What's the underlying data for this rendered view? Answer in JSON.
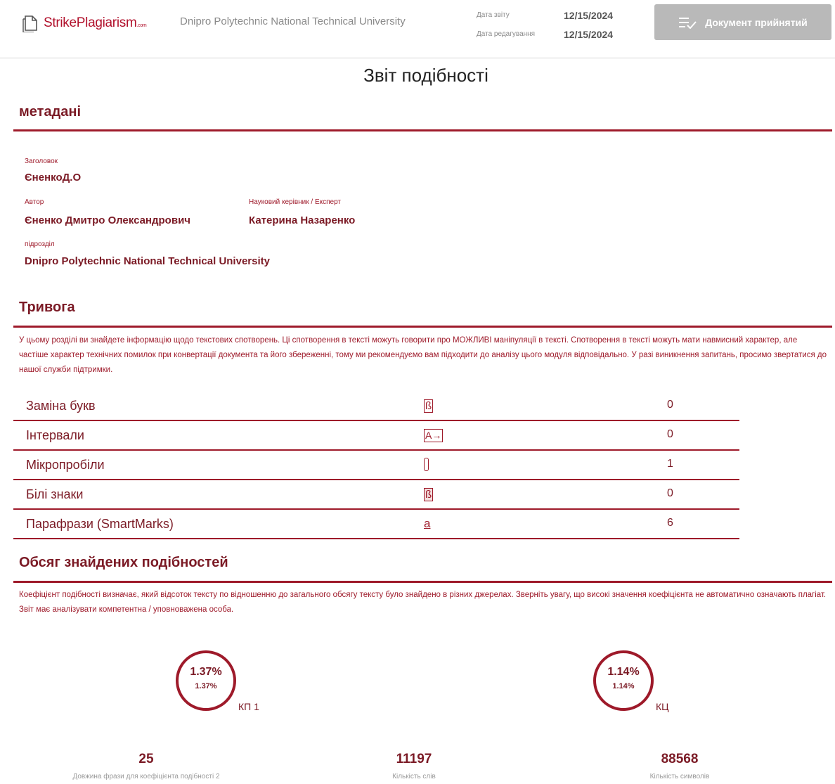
{
  "header": {
    "logo": {
      "strike": "Strike",
      "plagiarism": "Plagiarism",
      "com": ".com"
    },
    "university": "Dnipro Polytechnic National Technical University",
    "report_date_label": "Дата звіту",
    "report_date": "12/15/2024",
    "edit_date_label": "Дата редагування",
    "edit_date": "12/15/2024",
    "accept_button": "Документ прийнятий"
  },
  "title": "Звіт подібності",
  "metadata": {
    "heading": "метадані",
    "title_label": "Заголовок",
    "title_value": "ЄненкоД.О",
    "author_label": "Автор",
    "author_value": "Єненко Дмитро Олександрович",
    "supervisor_label": "Науковий керівник / Експерт",
    "supervisor_value": "Катерина Назаренко",
    "unit_label": "підрозділ",
    "unit_value": "Dnipro Polytechnic National Technical University"
  },
  "alert": {
    "heading": "Тривога",
    "description": "У цьому розділі ви знайдете інформацію щодо текстових спотворень. Ці спотворення в тексті можуть говорити про МОЖЛИВІ маніпуляції в тексті. Спотворення в тексті можуть мати навмисний характер, але частіше характер технічних помилок при конвертації документа та його збереженні, тому ми рекомендуємо вам підходити до аналізу цього модуля відповідально. У разі виникнення запитань, просимо звертатися до нашої служби підтримки.",
    "rows": [
      {
        "name": "Заміна букв",
        "icon": "letter-replace-icon",
        "glyph": "ß",
        "count": "0"
      },
      {
        "name": "Інтервали",
        "icon": "interval-arrow-icon",
        "glyph": "A→",
        "count": "0"
      },
      {
        "name": "Мікропробіли",
        "icon": "micro-space-icon",
        "glyph": "",
        "count": "1"
      },
      {
        "name": "Білі знаки",
        "icon": "white-chars-icon",
        "glyph": "ß",
        "count": "0"
      },
      {
        "name": "Парафрази (SmartMarks)",
        "icon": "paraphrase-icon",
        "glyph": "a",
        "count": "6"
      }
    ]
  },
  "similarity": {
    "heading": "Обсяг знайдених подібностей",
    "description": "Коефіцієнт подібності визначає, який відсоток тексту по відношенню до загального обсягу тексту було знайдено в різних джерелах. Зверніть увагу, що високі значення коефіцієнта не автоматично означають плагіат. Звіт має аналізувати компетентна / уповноважена особа.",
    "coef1": {
      "big": "1.37%",
      "small": "1.37%",
      "label": "КП 1"
    },
    "coef2": {
      "big": "1.14%",
      "small": "1.14%",
      "label": "КЦ"
    },
    "stats": [
      {
        "value": "25",
        "label": "Довжина фрази для коефіцієнта подібності 2"
      },
      {
        "value": "11197",
        "label": "Кількість слів"
      },
      {
        "value": "88568",
        "label": "Кількість символів"
      }
    ]
  },
  "colors": {
    "accent": "#9e1a2a",
    "accent_dark": "#7b1a25",
    "button_bg": "#b9b9b9"
  }
}
